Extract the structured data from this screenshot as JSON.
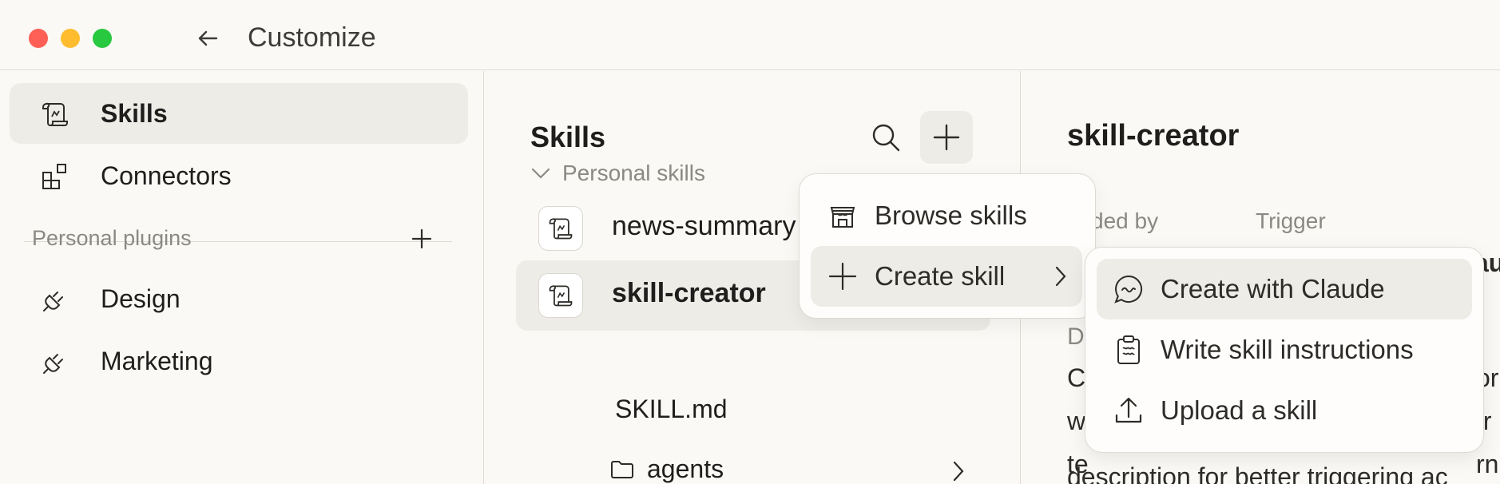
{
  "window": {
    "title": "Customize"
  },
  "sidebar": {
    "items": [
      {
        "label": "Skills",
        "icon": "scroll-icon",
        "active": true
      },
      {
        "label": "Connectors",
        "icon": "blocks-icon",
        "active": false
      }
    ],
    "plugins_label": "Personal plugins",
    "plugins": [
      {
        "label": "Design",
        "icon": "plug-icon"
      },
      {
        "label": "Marketing",
        "icon": "plug-icon"
      }
    ]
  },
  "skills_panel": {
    "title": "Skills",
    "group_label": "Personal skills",
    "skills": [
      {
        "name": "news-summary",
        "active": false
      },
      {
        "name": "skill-creator",
        "active": true
      }
    ],
    "files": [
      {
        "name": "SKILL.md"
      },
      {
        "name": "agents"
      }
    ]
  },
  "detail": {
    "title": "skill-creator",
    "added_by_fragment": "ded by",
    "trigger_label": "Trigger",
    "trigger_fragment": "au",
    "desc_label_fragment": "D",
    "desc_lines": [
      "C",
      "w",
      "te",
      "description for better triggering ac"
    ],
    "desc_right": [
      "or",
      "fr",
      "rn"
    ]
  },
  "add_menu": {
    "items": [
      {
        "label": "Browse skills",
        "icon": "store-icon"
      },
      {
        "label": "Create skill",
        "icon": "plus-icon",
        "has_submenu": true
      }
    ]
  },
  "create_submenu": {
    "items": [
      {
        "label": "Create with Claude",
        "icon": "chat-bubble-icon"
      },
      {
        "label": "Write skill instructions",
        "icon": "clipboard-icon"
      },
      {
        "label": "Upload a skill",
        "icon": "upload-icon"
      }
    ]
  }
}
